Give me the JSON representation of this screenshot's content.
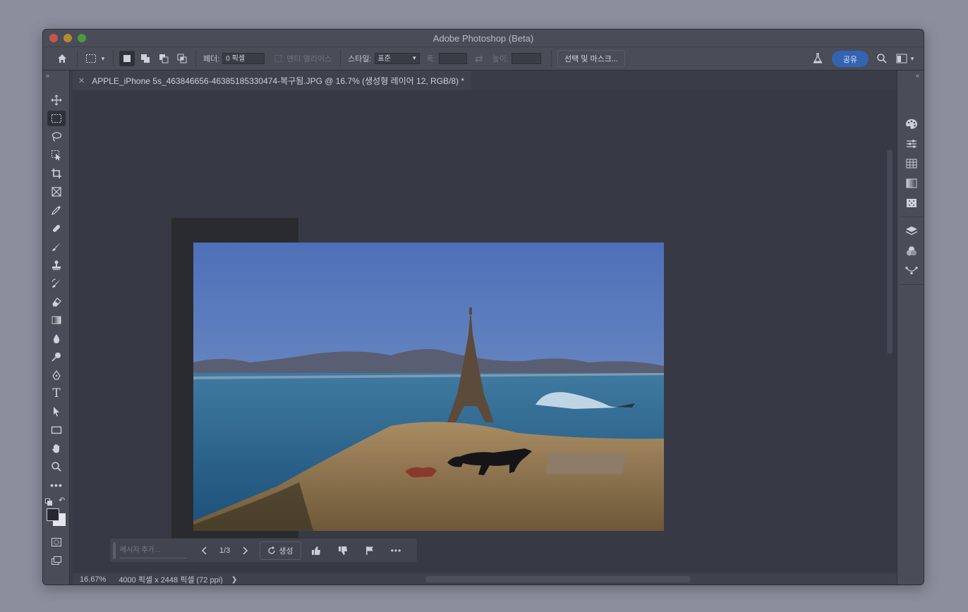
{
  "window": {
    "title": "Adobe Photoshop (Beta)"
  },
  "options_bar": {
    "feather_label": "페더:",
    "feather_value": "0 픽셀",
    "antialias_label": "앤티 앨리어스",
    "style_label": "스타일:",
    "style_value": "표준",
    "width_label": "폭:",
    "height_label": "높이:",
    "select_mask_label": "선택 및 마스크...",
    "share_label": "공유"
  },
  "document_tab": {
    "label": "APPLE_iPhone 5s_463846656-46385185330474-복구됨.JPG @ 16.7% (생성형 레이어 12, RGB/8) *"
  },
  "contextual_taskbar": {
    "prompt_placeholder": "메시지 추가...",
    "variation_counter": "1/3",
    "generate_label": "생성"
  },
  "status_bar": {
    "zoom": "16.67%",
    "doc_info": "4000 픽셀 x 2448 픽셀 (72 ppi)"
  },
  "colors": {
    "accent": "#3264b2",
    "panel_bg": "#4a4d58",
    "canvas_bg": "#373a45"
  }
}
